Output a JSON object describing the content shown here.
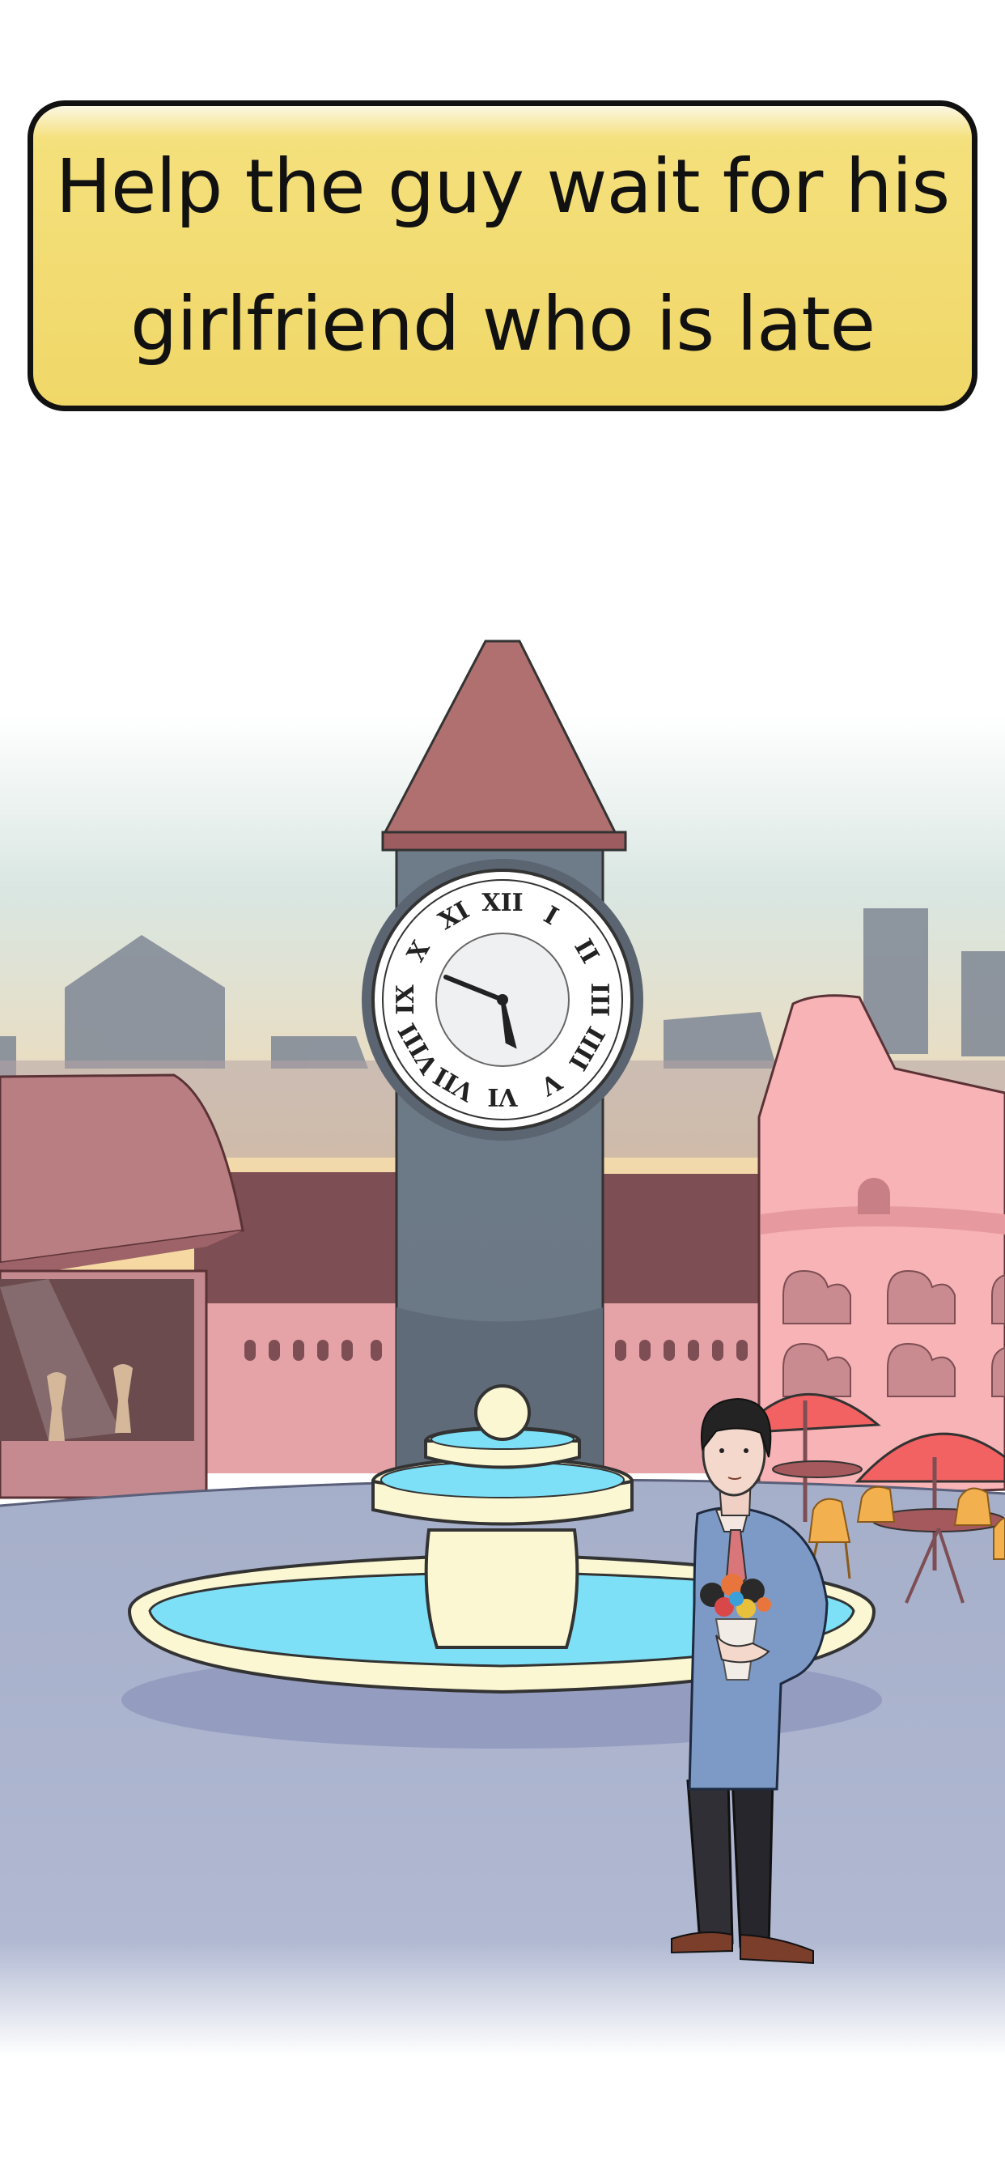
{
  "hint": {
    "text": "Help the guy wait for his girlfriend who is late"
  },
  "scene": {
    "clock": {
      "numerals": [
        "XII",
        "I",
        "II",
        "III",
        "IIII",
        "V",
        "VI",
        "VII",
        "VIII",
        "IX",
        "X",
        "XI"
      ]
    },
    "colors": {
      "banner": "#f0d768",
      "sky_top": "#ffffff",
      "sky_mid": "#d8e5e1",
      "sky_horizon": "#f6d9a6",
      "tower_roof": "#b07070",
      "tower": "#6f7d89",
      "plaza": "#aab3cc",
      "fountain_water": "#7ee0f7",
      "fountain_stone": "#fbf7d2",
      "umbrella": "#f26262",
      "building_pink": "#f7b3b5"
    }
  }
}
